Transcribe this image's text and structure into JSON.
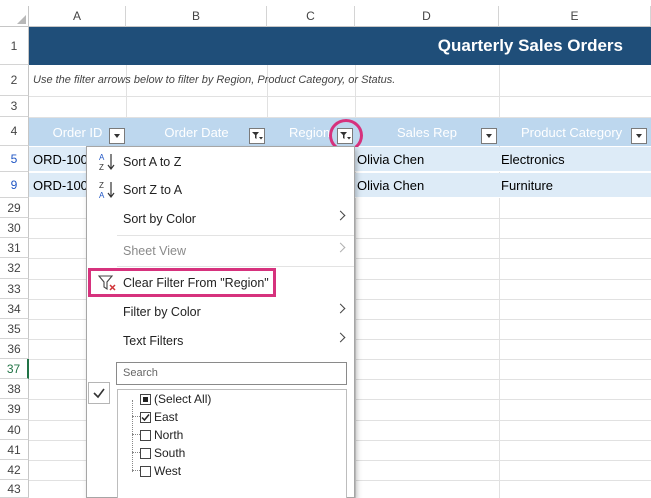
{
  "columns": [
    "A",
    "B",
    "C",
    "D",
    "E"
  ],
  "rows": [
    "1",
    "2",
    "3",
    "4",
    "5",
    "9",
    "29",
    "30",
    "31",
    "32",
    "33",
    "34",
    "35",
    "36",
    "37",
    "38",
    "39",
    "40",
    "41",
    "42",
    "43"
  ],
  "sheet": {
    "title": "Quarterly Sales Orders",
    "instruction": "Use the filter arrows below to filter by Region, Product Category, or Status.",
    "headers": [
      "Order ID",
      "Order Date",
      "Region",
      "Sales Rep",
      "Product Category"
    ],
    "data_rows": [
      {
        "order_id": "ORD-100",
        "sales_rep": "Olivia Chen",
        "category": "Electronics"
      },
      {
        "order_id": "ORD-100",
        "sales_rep": "Olivia Chen",
        "category": "Furniture"
      }
    ]
  },
  "menu": {
    "sort_az": "Sort A to Z",
    "sort_za": "Sort Z to A",
    "sort_by_color": "Sort by Color",
    "sheet_view": "Sheet View",
    "clear_filter": "Clear Filter From \"Region\"",
    "filter_by_color": "Filter by Color",
    "text_filters": "Text Filters",
    "search_placeholder": "Search",
    "items": [
      {
        "label": "(Select All)",
        "state": "indeterminate"
      },
      {
        "label": "East",
        "state": "checked"
      },
      {
        "label": "North",
        "state": "unchecked"
      },
      {
        "label": "South",
        "state": "unchecked"
      },
      {
        "label": "West",
        "state": "unchecked"
      }
    ]
  },
  "colors": {
    "title_band": "#1f4e79",
    "header_band": "#bdd7ee",
    "data_row": "#ddebf7",
    "highlight": "#d6327d",
    "active_row": "#217346"
  }
}
